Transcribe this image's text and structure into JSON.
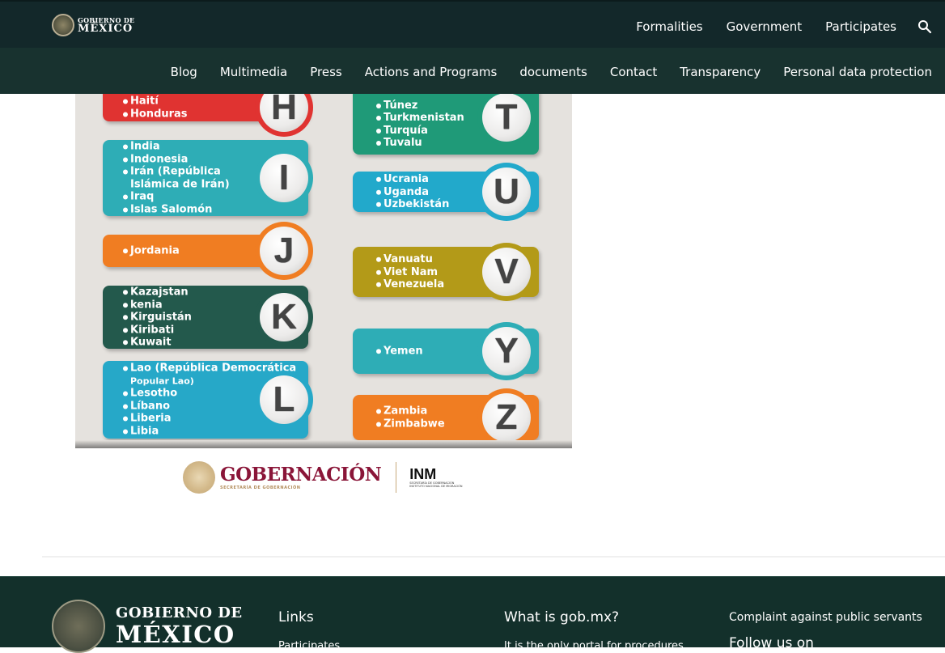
{
  "header": {
    "logo": {
      "line1": "GOBIERNO DE",
      "line2": "MÉXICO"
    },
    "top_nav": [
      "Formalities",
      "Government",
      "Participates"
    ],
    "search_icon": "search-icon",
    "sub_nav": [
      "Blog",
      "Multimedia",
      "Press",
      "Actions and Programs",
      "documents",
      "Contact",
      "Transparency",
      "Personal data protection"
    ]
  },
  "infographic": {
    "left_cards": [
      {
        "letter": "H",
        "color": "#e03331",
        "countries": [
          "Haití",
          "Honduras"
        ]
      },
      {
        "letter": "I",
        "color": "#2eadb6",
        "countries": [
          "India",
          "Indonesia",
          "Irán (República",
          "Islámica de Irán)",
          "Iraq",
          "Islas Salomón"
        ]
      },
      {
        "letter": "J",
        "color": "#f07d22",
        "countries": [
          "Jordania"
        ]
      },
      {
        "letter": "K",
        "color": "#23594c",
        "countries": [
          "Kazajstan",
          "kenia",
          "Kirguistán",
          "Kiribati",
          "Kuwait"
        ]
      },
      {
        "letter": "L",
        "color": "#26a8c8",
        "countries": [
          "Lao (República Democrática",
          "Popular Lao)",
          "Lesotho",
          "Líbano",
          "Liberia",
          "Libia"
        ]
      }
    ],
    "right_cards": [
      {
        "letter": "T",
        "color": "#1f9a78",
        "countries": [
          "Túnez",
          "Turkmenistan",
          "Turquía",
          "Tuvalu"
        ]
      },
      {
        "letter": "U",
        "color": "#22a9cb",
        "countries": [
          "Ucrania",
          "Uganda",
          "Uzbekistán"
        ]
      },
      {
        "letter": "V",
        "color": "#b39a18",
        "countries": [
          "Vanuatu",
          "Viet Nam",
          "Venezuela"
        ]
      },
      {
        "letter": "Y",
        "color": "#2eadb6",
        "countries": [
          "Yemen"
        ]
      },
      {
        "letter": "Z",
        "color": "#f07d22",
        "countries": [
          "Zambia",
          "Zimbabwe"
        ]
      }
    ]
  },
  "sponsor_logos": {
    "gobernacion": {
      "title": "GOBERNACIÓN",
      "subtitle": "SECRETARÍA DE GOBERNACIÓN"
    },
    "inm": {
      "title": "INM",
      "subtitle1": "SECRETARÍA DE GOBERNACIÓN",
      "subtitle2": "INSTITUTO NACIONAL DE MIGRACIÓN"
    }
  },
  "footer": {
    "logo": {
      "line1": "GOBIERNO DE",
      "line2": "MÉXICO"
    },
    "links_heading": "Links",
    "links_first": "Participates",
    "about_heading": "What is gob.mx?",
    "about_text": "It is the only portal for procedures",
    "complaint_link": "Complaint against public servants",
    "follow_heading": "Follow us on"
  }
}
